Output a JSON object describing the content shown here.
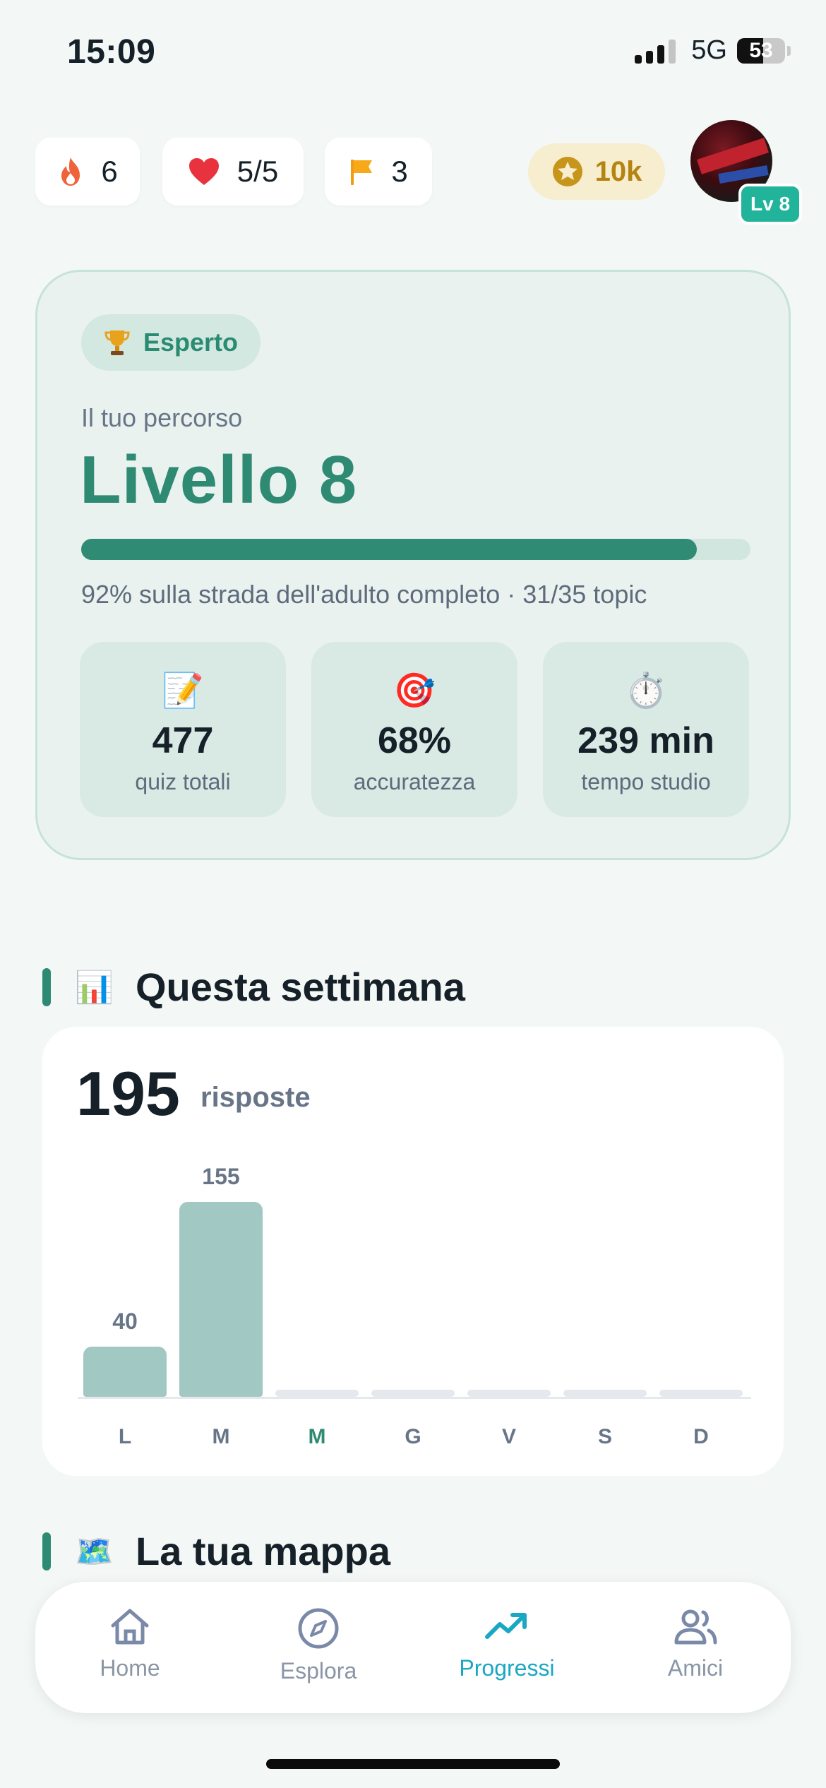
{
  "status_bar": {
    "time": "15:09",
    "network": "5G",
    "battery": "53"
  },
  "top_chips": {
    "streak": {
      "icon": "flame-icon",
      "value": "6"
    },
    "lives": {
      "icon": "heart-icon",
      "value": "5/5"
    },
    "flags": {
      "icon": "flag-icon",
      "value": "3"
    },
    "coins": {
      "icon": "star-coin-icon",
      "value": "10k"
    },
    "avatar_level": "Lv 8"
  },
  "level_card": {
    "rank": "Esperto",
    "subtitle": "Il tuo percorso",
    "title": "Livello 8",
    "progress_fraction": 0.92,
    "progress_text": "92% sulla strada dell'adulto completo · 31/35 topic",
    "stats": [
      {
        "emoji": "📝",
        "value": "477",
        "label": "quiz totali"
      },
      {
        "emoji": "🎯",
        "value": "68%",
        "label": "accuratezza"
      },
      {
        "emoji": "⏱️",
        "value": "239 min",
        "label": "tempo studio"
      }
    ]
  },
  "week_section": {
    "emoji": "📊",
    "title": "Questa settimana",
    "total": "195",
    "unit": "risposte"
  },
  "chart_data": {
    "type": "bar",
    "categories": [
      "L",
      "M",
      "M",
      "G",
      "V",
      "S",
      "D"
    ],
    "values": [
      40,
      155,
      0,
      0,
      0,
      0,
      0
    ],
    "value_labels": [
      "40",
      "155",
      "",
      "",
      "",
      "",
      ""
    ],
    "highlight_category_index": 2,
    "ylim": [
      0,
      155
    ],
    "grid": false
  },
  "map_section": {
    "emoji": "🗺️",
    "title": "La tua mappa"
  },
  "nav": {
    "items": [
      {
        "label": "Home",
        "icon": "home-icon",
        "active": false
      },
      {
        "label": "Esplora",
        "icon": "compass-icon",
        "active": false
      },
      {
        "label": "Progressi",
        "icon": "trending-up-icon",
        "active": true
      },
      {
        "label": "Amici",
        "icon": "friends-icon",
        "active": false
      }
    ]
  },
  "colors": {
    "accent": "#2e8a73",
    "nav_active": "#1aa7c4",
    "bar": "#a1c8c2",
    "coin": "#b58410"
  }
}
